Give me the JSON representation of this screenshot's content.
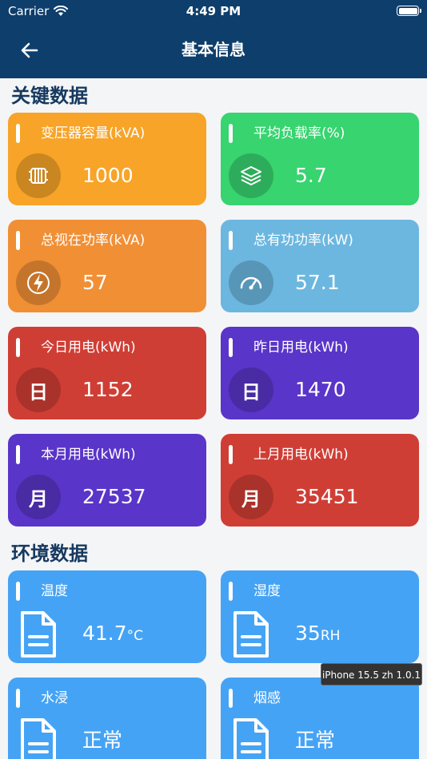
{
  "status": {
    "carrier": "Carrier",
    "time": "4:49 PM"
  },
  "nav": {
    "title": "基本信息"
  },
  "sections": {
    "key": "关键数据",
    "env": "环境数据"
  },
  "key_cards": [
    {
      "label": "变压器容量(kVA)",
      "value": "1000",
      "color": "#f7a428",
      "icon": "transformer-icon"
    },
    {
      "label": "平均负载率(%)",
      "value": "5.7",
      "color": "#37d46f",
      "icon": "layers-icon"
    },
    {
      "label": "总视在功率(kVA)",
      "value": "57",
      "color": "#f18f35",
      "icon": "lightning-icon"
    },
    {
      "label": "总有功功率(kW)",
      "value": "57.1",
      "color": "#6cb7e0",
      "icon": "gauge-icon"
    },
    {
      "label": "今日用电(kWh)",
      "value": "1152",
      "color": "#cf3e35",
      "icon": "day-icon",
      "glyph": "日"
    },
    {
      "label": "昨日用电(kWh)",
      "value": "1470",
      "color": "#5a35c9",
      "icon": "day-icon",
      "glyph": "日"
    },
    {
      "label": "本月用电(kWh)",
      "value": "27537",
      "color": "#5a35c9",
      "icon": "month-icon",
      "glyph": "月"
    },
    {
      "label": "上月用电(kWh)",
      "value": "35451",
      "color": "#cf3e35",
      "icon": "month-icon",
      "glyph": "月"
    }
  ],
  "env_cards": [
    {
      "label": "温度",
      "value": "41.7",
      "unit": "°C",
      "color": "#45a3f5",
      "icon": "document-icon"
    },
    {
      "label": "湿度",
      "value": "35",
      "unit": "RH",
      "color": "#45a3f5",
      "icon": "document-icon"
    },
    {
      "label": "水浸",
      "value": "正常",
      "unit": "",
      "color": "#45a3f5",
      "icon": "document-icon"
    },
    {
      "label": "烟感",
      "value": "正常",
      "unit": "",
      "color": "#45a3f5",
      "icon": "document-icon"
    }
  ],
  "tooltip": "iPhone 15.5 zh 1.0.1"
}
